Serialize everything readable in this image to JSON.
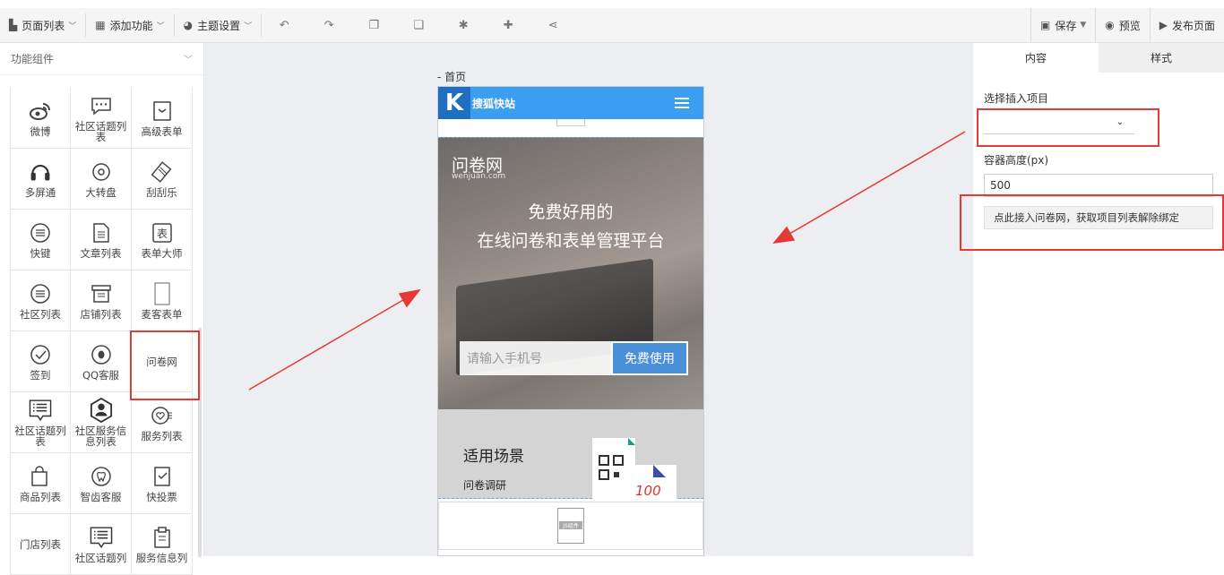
{
  "toolbar": {
    "page_list": "页面列表",
    "add_feature": "添加功能",
    "theme": "主题设置",
    "save": "保存",
    "preview": "预览",
    "publish": "发布页面"
  },
  "left": {
    "header": "功能组件",
    "components": [
      {
        "label": "微博",
        "icon": "weibo-icon"
      },
      {
        "label": "社区话题列表",
        "icon": "chat-bubble-icon"
      },
      {
        "label": "高级表单",
        "icon": "form-icon"
      },
      {
        "label": "多屏通",
        "icon": "headset-icon"
      },
      {
        "label": "大转盘",
        "icon": "wheel-icon"
      },
      {
        "label": "刮刮乐",
        "icon": "ticket-icon"
      },
      {
        "label": "快键",
        "icon": "list-circle-icon"
      },
      {
        "label": "文章列表",
        "icon": "document-icon"
      },
      {
        "label": "表单大师",
        "icon": "table-icon"
      },
      {
        "label": "社区列表",
        "icon": "list-circle-icon"
      },
      {
        "label": "店铺列表",
        "icon": "store-icon"
      },
      {
        "label": "麦客表单",
        "icon": "page-icon"
      },
      {
        "label": "签到",
        "icon": "check-circle-icon"
      },
      {
        "label": "QQ客服",
        "icon": "qq-icon"
      },
      {
        "label": "问卷网",
        "icon": "none"
      },
      {
        "label": "社区话题列表",
        "icon": "message-list-icon"
      },
      {
        "label": "社区服务信息列表",
        "icon": "service-shield-icon"
      },
      {
        "label": "服务列表",
        "icon": "heart-list-icon"
      },
      {
        "label": "商品列表",
        "icon": "bag-icon"
      },
      {
        "label": "智齿客服",
        "icon": "tooth-icon"
      },
      {
        "label": "快投票",
        "icon": "vote-icon"
      },
      {
        "label": "门店列表",
        "icon": "none"
      },
      {
        "label": "社区话题列",
        "icon": "message-list-icon"
      },
      {
        "label": "服务信息列",
        "icon": "clipboard-icon"
      }
    ]
  },
  "canvas": {
    "page_label": "- 首页",
    "site_title": "搜狐快站",
    "logo_letter": "K",
    "banner": {
      "logo": "问卷网",
      "logo_sub": "wenjuan.com",
      "headline1": "免费好用的",
      "headline2": "在线问卷和表单管理平台",
      "phone_placeholder": "请输入手机号",
      "cta": "免费使用"
    },
    "scene": {
      "title": "适用场景",
      "item": "问卷调研",
      "number": "100"
    },
    "js_label": "JS组件"
  },
  "right": {
    "tab_content": "内容",
    "tab_style": "样式",
    "select_label": "选择插入项目",
    "height_label": "容器高度(px)",
    "height_value": "500",
    "bind_button": "点此接入问卷网，获取项目列表解除绑定"
  },
  "colors": {
    "accent": "#3c9ef0",
    "highlight": "#e53935"
  }
}
